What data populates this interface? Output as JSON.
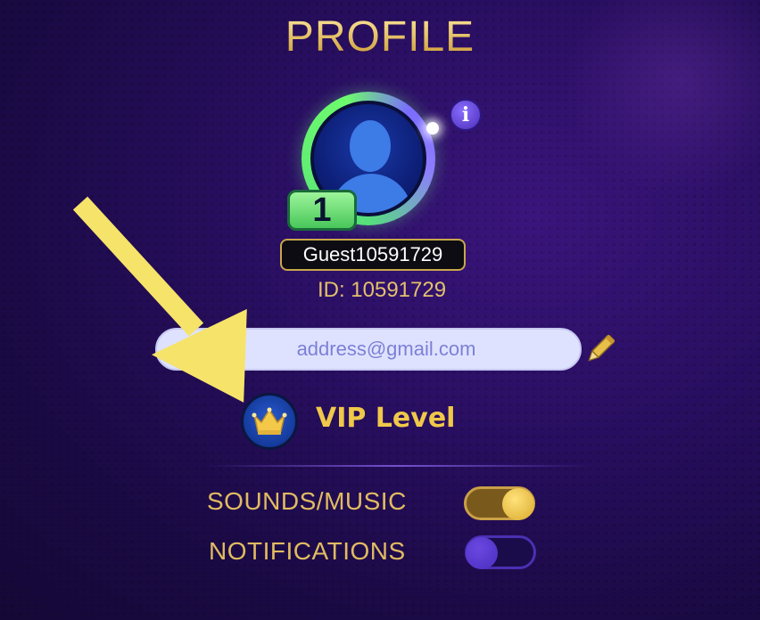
{
  "header": {
    "title": "PROFILE"
  },
  "profile": {
    "level": "1",
    "username": "Guest10591729",
    "id_text": "ID: 10591729",
    "email_placeholder": "address@gmail.com"
  },
  "vip": {
    "label": "VIP Level"
  },
  "settings": {
    "sounds_label": "SOUNDS/MUSIC",
    "sounds_on": true,
    "notifications_label": "NOTIFICATIONS",
    "notifications_on": false
  },
  "icons": {
    "info": "info-icon",
    "edit": "pencil-icon",
    "vip": "crown-icon",
    "avatar": "user-silhouette-icon",
    "annotation": "yellow-arrow-icon"
  },
  "colors": {
    "gold": "#e3c16c",
    "level_green": "#6fe27a",
    "arrow_yellow": "#f6e36a",
    "background": "#2a0f63"
  }
}
